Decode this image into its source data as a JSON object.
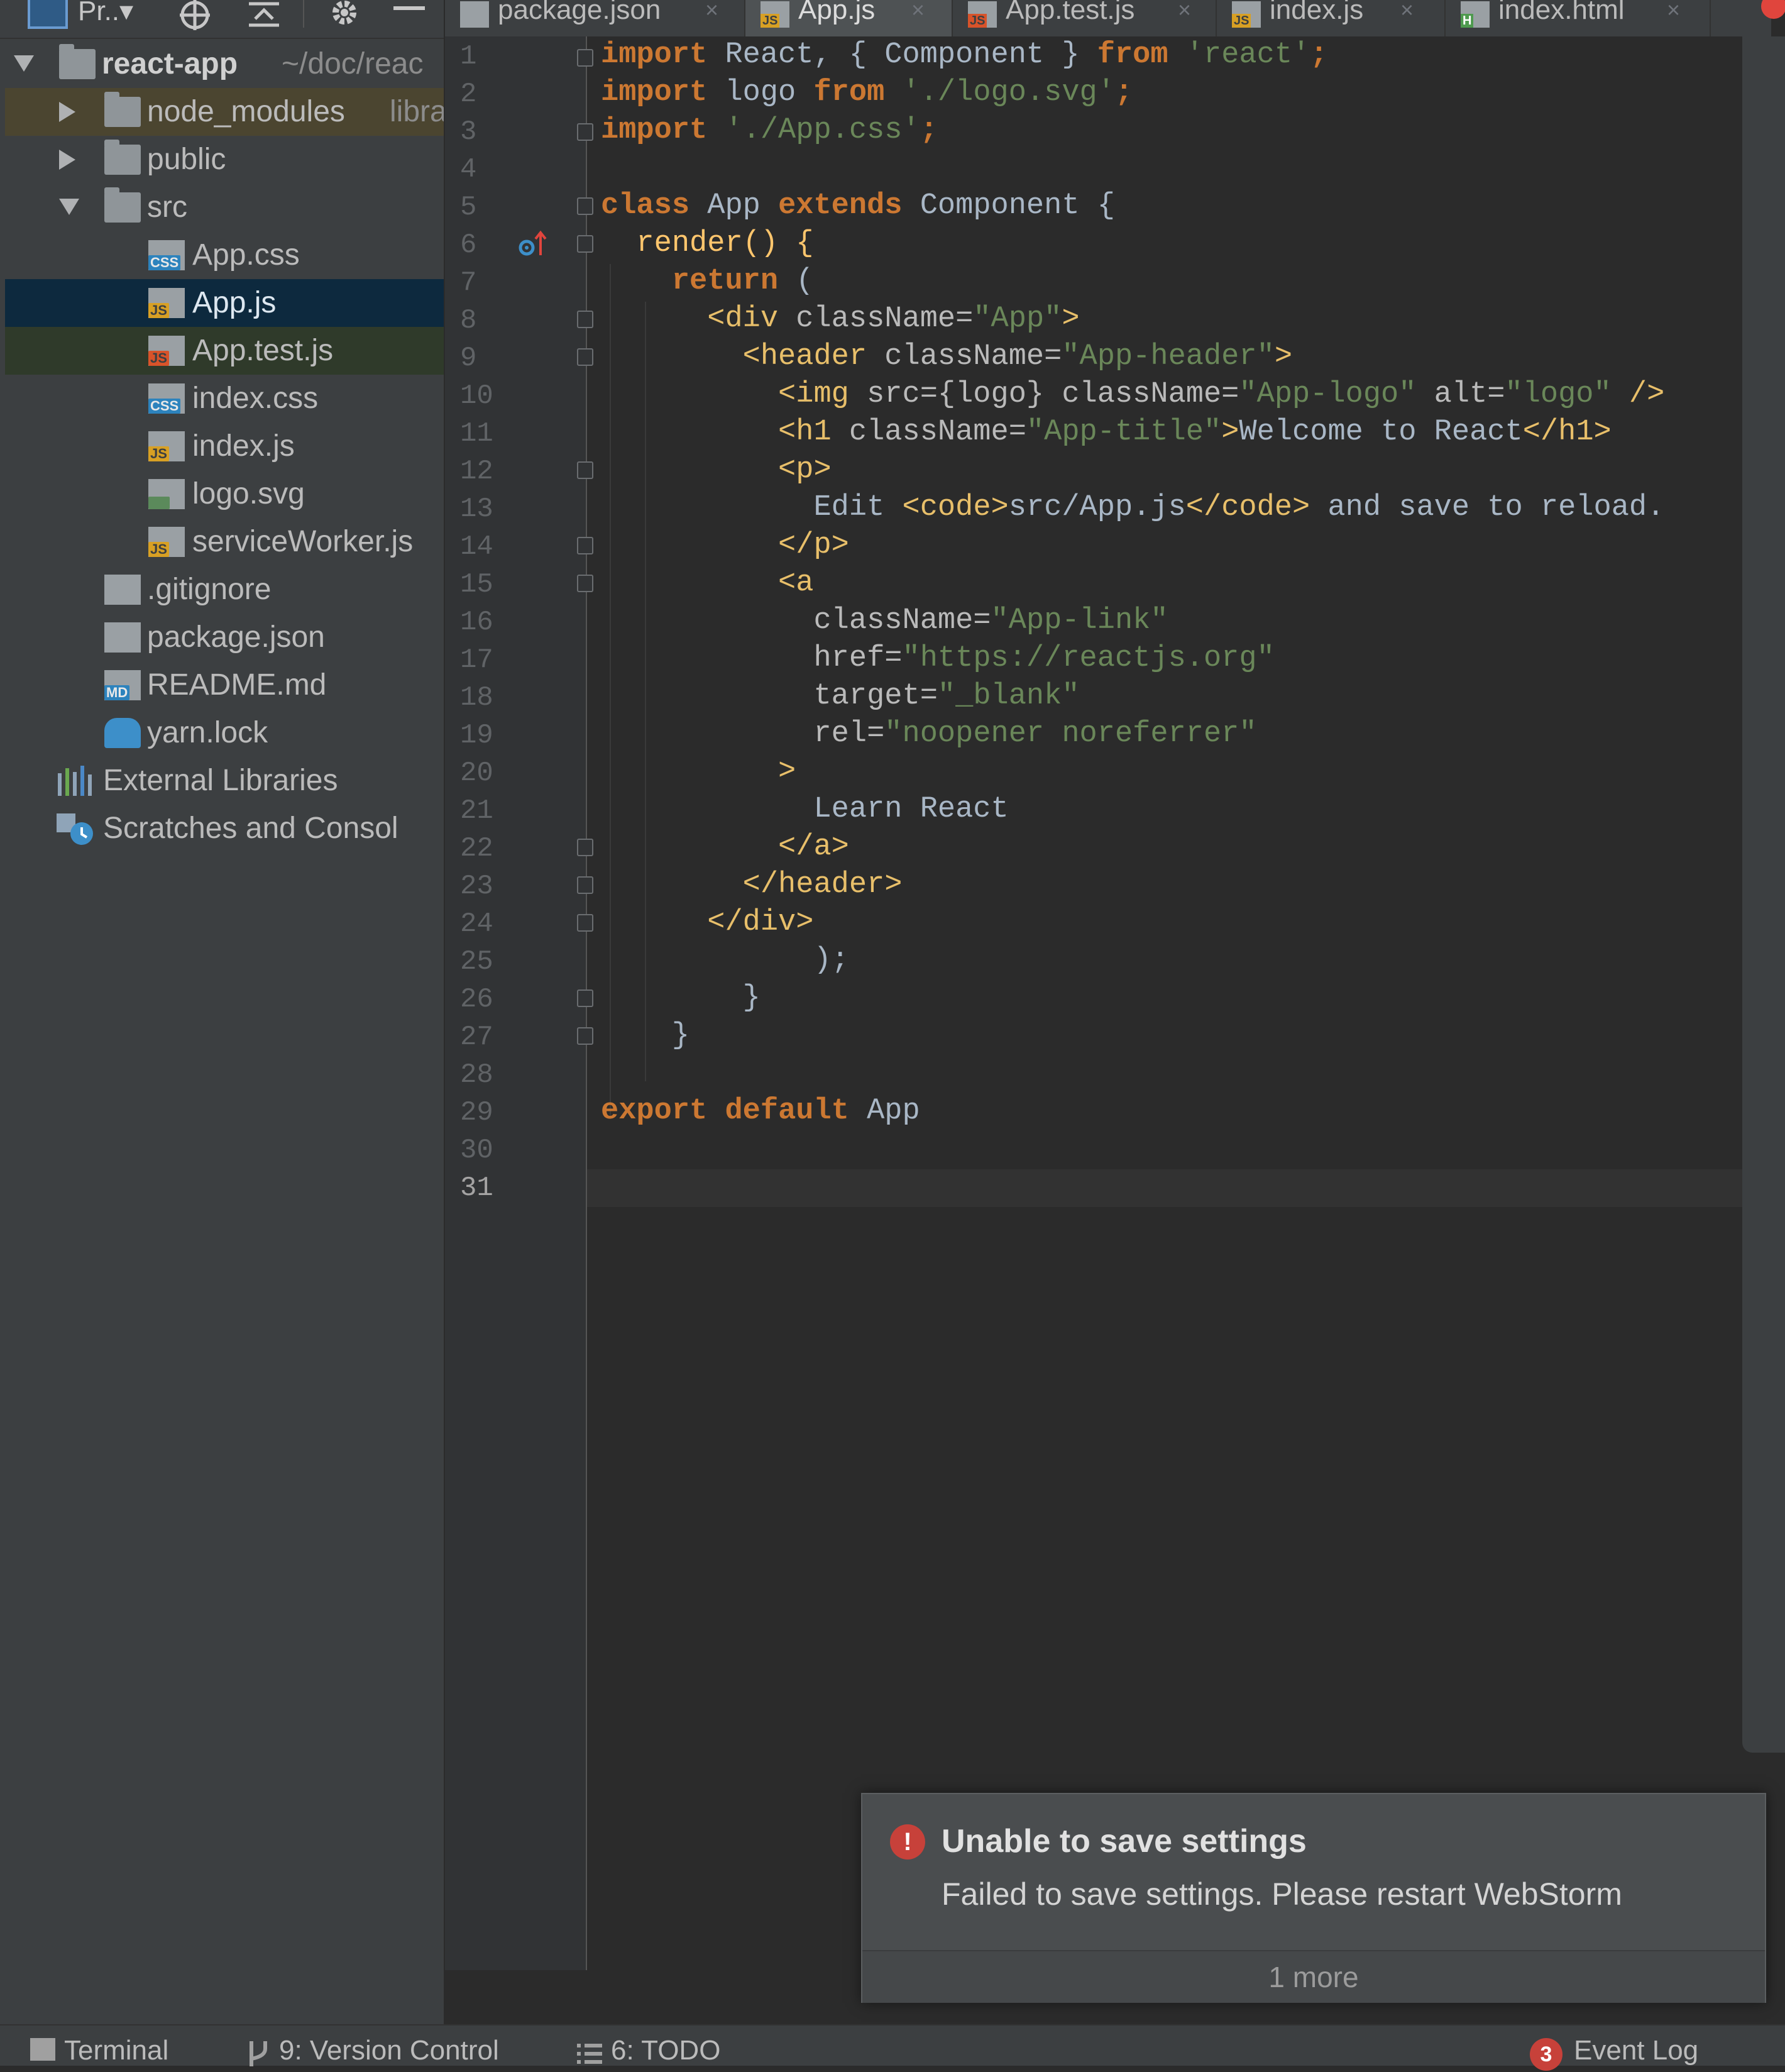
{
  "toolbar": {
    "project_label": "Pr..",
    "dropdown_arrow": "▾"
  },
  "tree": {
    "root_label": "react-app",
    "root_hint": "~/doc/reac",
    "items": [
      {
        "label": "node_modules",
        "hint": "libra"
      },
      {
        "label": "public"
      },
      {
        "label": "src"
      },
      {
        "label": "App.css",
        "badge": "CSS"
      },
      {
        "label": "App.js",
        "badge": "JS"
      },
      {
        "label": "App.test.js",
        "badge": "JS"
      },
      {
        "label": "index.css",
        "badge": "CSS"
      },
      {
        "label": "index.js",
        "badge": "JS"
      },
      {
        "label": "logo.svg"
      },
      {
        "label": "serviceWorker.js",
        "badge": "JS"
      },
      {
        "label": ".gitignore"
      },
      {
        "label": "package.json"
      },
      {
        "label": "README.md",
        "badge": "MD"
      },
      {
        "label": "yarn.lock"
      },
      {
        "label": "External Libraries"
      },
      {
        "label": "Scratches and Consol"
      }
    ]
  },
  "tabs": [
    {
      "label": "package.json",
      "badge": ""
    },
    {
      "label": "App.js",
      "badge": "JS"
    },
    {
      "label": "App.test.js",
      "badge": "JS"
    },
    {
      "label": "index.js",
      "badge": "JS"
    },
    {
      "label": "index.html",
      "badge": "H"
    }
  ],
  "tab_close": "×",
  "editor": {
    "current_line": 31,
    "line_numbers": [
      "1",
      "2",
      "3",
      "4",
      "5",
      "6",
      "7",
      "8",
      "9",
      "10",
      "11",
      "12",
      "13",
      "14",
      "15",
      "16",
      "17",
      "18",
      "19",
      "20",
      "21",
      "22",
      "23",
      "24",
      "25",
      "26",
      "27",
      "28",
      "29",
      "30",
      "31"
    ],
    "tokens": {
      "import": "import",
      "from": "from",
      "class": "class",
      "extends": "extends",
      "return": "return",
      "export": "export",
      "default": "default",
      "l1_mid": " React, { Component } ",
      "l1_str": "'react'",
      "semi": ";",
      "l2_mid": " logo ",
      "l2_str": "'./logo.svg'",
      "l3_str": " './App.css'",
      "l5_mid": " App ",
      "l5_end": " Component {",
      "l6": "render() {",
      "l7_end": " (",
      "l8_tag_open": "<div",
      "l8_attr": " className=",
      "l8_str": "\"App\"",
      "gt": ">",
      "l9_tag_open": "<header",
      "l9_str": "\"App-header\"",
      "l10_tag_open": "<img",
      "l10_attr1": " src={logo}",
      "l10_str1": "\"App-logo\"",
      "l10_attr3": " alt=",
      "l10_str2": "\"logo\"",
      "l10_close": " />",
      "l11_tag_open": "<h1",
      "l11_str": "\"App-title\"",
      "l11_text": "Welcome to React",
      "l11_tag_close": "</h1>",
      "l12": "<p>",
      "l13_text1": "Edit ",
      "l13_code_open": "<code>",
      "l13_code_text": "src/App.js",
      "l13_code_close": "</code>",
      "l13_text2": " and save to reload.",
      "l14": "</p>",
      "l15": "<a",
      "l16_attr": "className=",
      "l16_str": "\"App-link\"",
      "l17_attr": "href=",
      "l17_str": "\"https://reactjs.org\"",
      "l18_attr": "target=",
      "l18_str": "\"_blank\"",
      "l19_attr": "rel=",
      "l19_str": "\"noopener noreferrer\"",
      "l20": ">",
      "l21": "Learn React",
      "l22": "</a>",
      "l23": "</header>",
      "l24": "</div>",
      "l25": ");",
      "l26": "}",
      "l27": "}",
      "l29_end": " App"
    }
  },
  "notification": {
    "icon": "!",
    "title": "Unable to save settings",
    "body": "Failed to save settings. Please restart WebStorm",
    "more": "1 more"
  },
  "status_bar": {
    "terminal": "Terminal",
    "version_control": "9: Version Control",
    "todo": "6: TODO",
    "event_log": "Event Log",
    "event_count": "3"
  },
  "colors": {
    "panel_bg": "#3c3f41",
    "editor_bg": "#2b2b2b",
    "keyword": "#cc7832",
    "string": "#6a8759",
    "tag": "#e8bf6a",
    "selection": "#0d293e",
    "error": "#c7413a"
  }
}
